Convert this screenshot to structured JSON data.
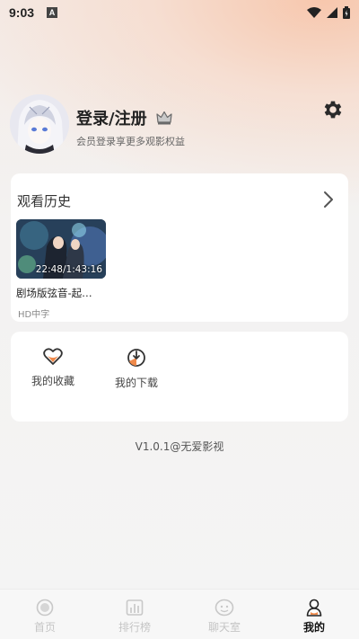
{
  "status_bar": {
    "time": "9:03",
    "notification_letter": "A"
  },
  "profile": {
    "login_label": "登录/注册",
    "subtitle": "会员登录享更多观影权益"
  },
  "history": {
    "title": "观看历史",
    "items": [
      {
        "title": "剧场版弦音-起…",
        "progress_time": "22:48/1:43:16",
        "tag": "HD中字"
      }
    ]
  },
  "actions": {
    "favorites_label": "我的收藏",
    "downloads_label": "我的下载"
  },
  "version": "V1.0.1@无爱影视",
  "tabs": [
    {
      "label": "首页"
    },
    {
      "label": "排行榜"
    },
    {
      "label": "聊天室"
    },
    {
      "label": "我的"
    }
  ],
  "colors": {
    "accent_orange": "#f08a4b",
    "active_tab": "#111111",
    "inactive_tab": "#c5c5c5"
  }
}
